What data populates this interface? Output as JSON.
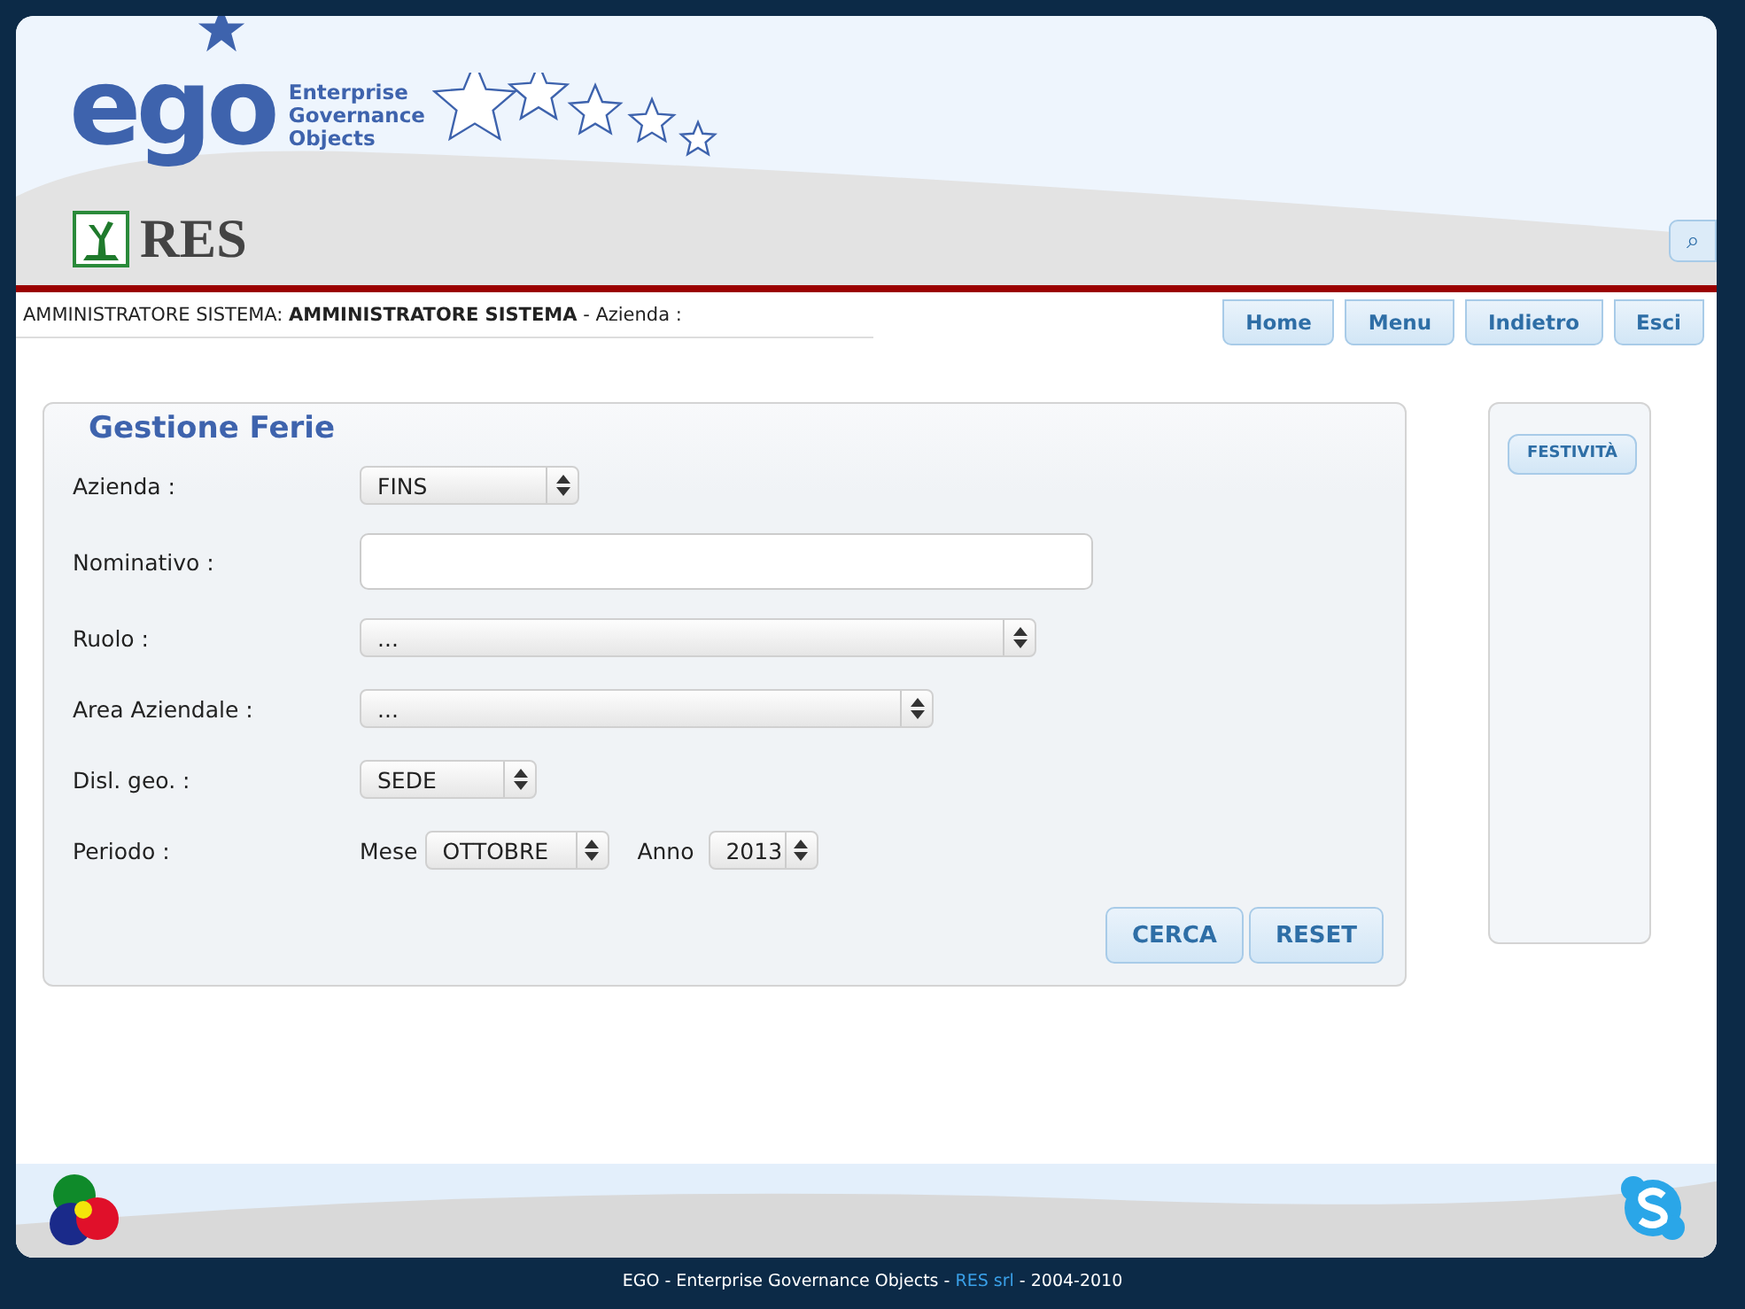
{
  "header": {
    "logo_text": "ego",
    "logo_tagline": [
      "Enterprise",
      "Governance",
      "Objects"
    ],
    "company_text": "RES",
    "search_button": "⌕"
  },
  "user_bar": {
    "role": "AMMINISTRATORE SISTEMA:",
    "name": "AMMINISTRATORE SISTEMA",
    "company": "- Azienda :"
  },
  "nav_buttons": [
    "Home",
    "Menu",
    "Indietro",
    "Esci"
  ],
  "form": {
    "title": "Gestione Ferie",
    "fields": [
      {
        "kind": "select",
        "label": "Azienda :",
        "value": "FINS"
      },
      {
        "kind": "text",
        "label": "Nominativo :"
      },
      {
        "kind": "select",
        "label": "Ruolo :",
        "value": "..."
      },
      {
        "kind": "select",
        "label": "Area Aziendale :",
        "value": "..."
      },
      {
        "kind": "select",
        "label": "Disl. geo. :",
        "value": "SEDE"
      },
      {
        "kind": "period",
        "label": "Periodo :",
        "month_label": "Mese",
        "month": "OTTOBRE",
        "year_label": "Anno",
        "year": "2013"
      }
    ],
    "buttons": [
      "CERCA",
      "RESET"
    ]
  },
  "side_panel": {
    "buttons": [
      "FESTIVITÀ"
    ]
  },
  "footer": {
    "text_before": "EGO - Enterprise Governance Objects -",
    "link": "RES srl",
    "text_after": "- 2004-2010"
  }
}
